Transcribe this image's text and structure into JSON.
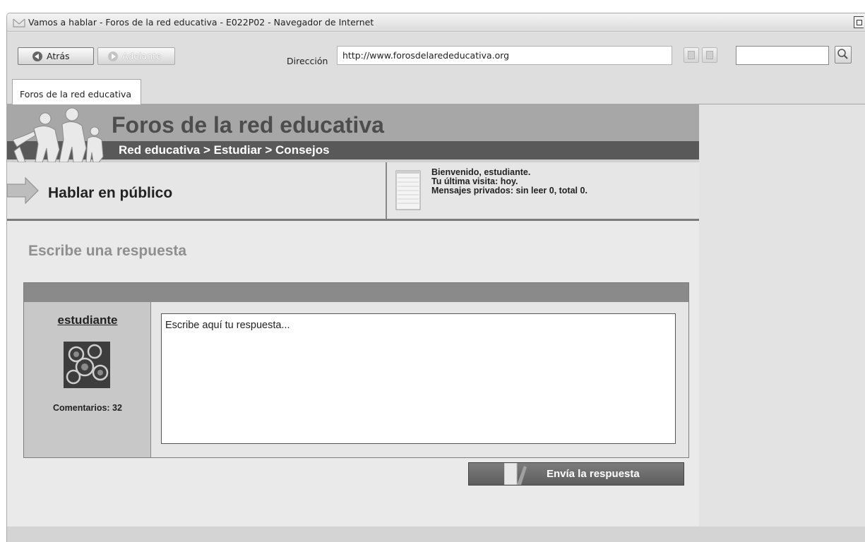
{
  "window": {
    "title": "Vamos a hablar - Foros de la red educativa - E022P02 - Navegador de Internet"
  },
  "toolbar": {
    "back_label": "Atrás",
    "forward_label": "Adelante",
    "address_label": "Dirección",
    "address_value": "http://www.forosdelarededucativa.org",
    "search_value": ""
  },
  "tabs": [
    {
      "label": "Foros de la red educativa",
      "active": true
    }
  ],
  "forum": {
    "title": "Foros de la red educativa",
    "breadcrumb": "Red educativa > Estudiar > Consejos"
  },
  "topic": {
    "title": "Hablar en público"
  },
  "welcome": {
    "line1": "Bienvenido, estudiante.",
    "line2": "Tu última visita: hoy.",
    "line3": "Mensajes privados: sin leer 0, total 0."
  },
  "reply": {
    "heading": "Escribe una respuesta",
    "username": "estudiante",
    "comments": "Comentarios: 32",
    "placeholder": "Escribe aquí tu respuesta...",
    "submit_label": "Envía la respuesta"
  },
  "icons": {
    "browser": "envelope-icon",
    "back": "back-arrow-icon",
    "forward": "forward-arrow-icon",
    "search": "magnifier-icon",
    "topic": "arrow-right-icon",
    "welcome": "notepad-icon",
    "submit": "document-icon"
  }
}
